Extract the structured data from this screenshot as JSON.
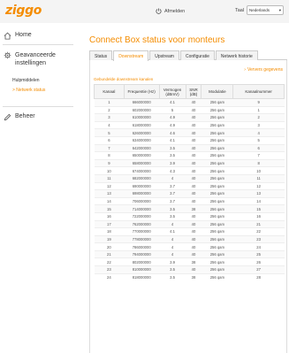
{
  "header": {
    "logo": "ziggo",
    "logout_label": "Afmelden",
    "language_label": "Taal",
    "language_value": "Nederlands"
  },
  "sidebar": {
    "home": "Home",
    "advanced": "Geavanceerde instellingen",
    "tools_heading": "Hulpmiddelen",
    "network_status": "> Netwerk status",
    "manage": "Beheer"
  },
  "main": {
    "title": "Connect Box status voor monteurs",
    "tabs": [
      "Status",
      "Downstream",
      "Upstream",
      "Configuratie",
      "Netwerk historie"
    ],
    "active_tab": 1,
    "refresh_label": "Ververs gegevens",
    "section_title": "Gebundelde downstream kanalen",
    "table": {
      "headers": [
        "Kanaal",
        "Frequentie (Hz)",
        "Vermogen (dBmV)",
        "SNR (dB)",
        "Modulatie",
        "Kanaalnummer"
      ],
      "rows": [
        [
          "1",
          "666000000",
          "4.1",
          "40",
          "256 qam",
          "9"
        ],
        [
          "2",
          "602000000",
          "5",
          "40",
          "256 qam",
          "1"
        ],
        [
          "3",
          "610000000",
          "4.9",
          "40",
          "256 qam",
          "2"
        ],
        [
          "4",
          "618000000",
          "4.9",
          "40",
          "256 qam",
          "3"
        ],
        [
          "5",
          "626000000",
          "4.6",
          "40",
          "256 qam",
          "4"
        ],
        [
          "6",
          "634000000",
          "4.1",
          "40",
          "256 qam",
          "5"
        ],
        [
          "7",
          "642000000",
          "3.5",
          "40",
          "256 qam",
          "6"
        ],
        [
          "8",
          "650000000",
          "3.5",
          "40",
          "256 qam",
          "7"
        ],
        [
          "9",
          "658000000",
          "3.9",
          "40",
          "256 qam",
          "8"
        ],
        [
          "10",
          "674000000",
          "4.3",
          "40",
          "256 qam",
          "10"
        ],
        [
          "11",
          "682000000",
          "4",
          "40",
          "256 qam",
          "11"
        ],
        [
          "12",
          "690000000",
          "3.7",
          "40",
          "256 qam",
          "12"
        ],
        [
          "13",
          "698000000",
          "3.7",
          "40",
          "256 qam",
          "13"
        ],
        [
          "14",
          "706000000",
          "3.7",
          "40",
          "256 qam",
          "14"
        ],
        [
          "15",
          "714000000",
          "3.5",
          "38",
          "256 qam",
          "15"
        ],
        [
          "16",
          "722000000",
          "3.5",
          "40",
          "256 qam",
          "16"
        ],
        [
          "17",
          "762000000",
          "4",
          "40",
          "256 qam",
          "21"
        ],
        [
          "18",
          "770000000",
          "4.1",
          "40",
          "256 qam",
          "22"
        ],
        [
          "19",
          "778000000",
          "4",
          "40",
          "256 qam",
          "23"
        ],
        [
          "20",
          "786000000",
          "4",
          "40",
          "256 qam",
          "24"
        ],
        [
          "21",
          "794000000",
          "4",
          "40",
          "256 qam",
          "25"
        ],
        [
          "22",
          "802000000",
          "3.9",
          "38",
          "256 qam",
          "26"
        ],
        [
          "23",
          "810000000",
          "3.5",
          "40",
          "256 qam",
          "27"
        ],
        [
          "24",
          "818000000",
          "3.5",
          "38",
          "256 qam",
          "28"
        ]
      ]
    }
  },
  "colors": {
    "accent": "#f48c00",
    "topbar": "#f4f4f4"
  }
}
